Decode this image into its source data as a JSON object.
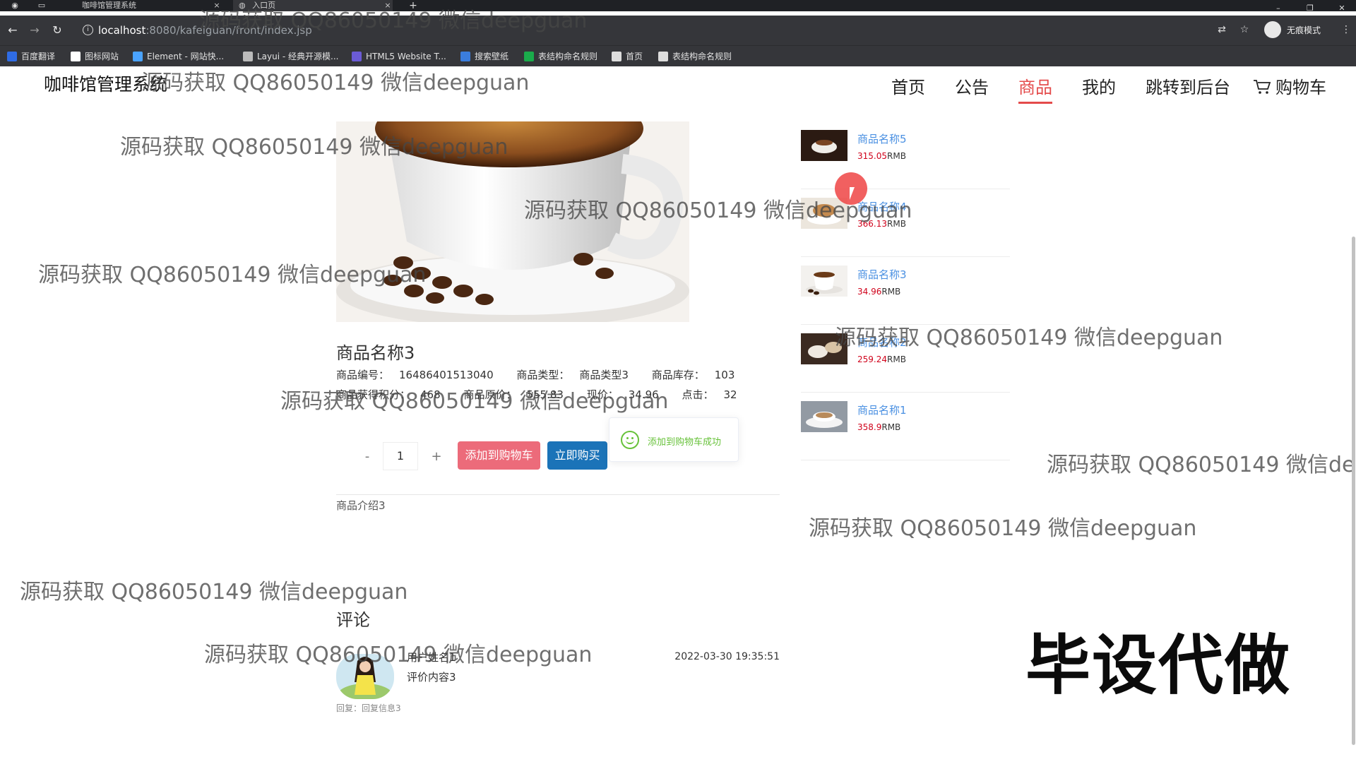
{
  "browser": {
    "tabs": [
      {
        "title": "咖啡馆管理系统",
        "close": "×"
      },
      {
        "title": "入口页",
        "close": "×"
      }
    ],
    "new_tab": "+",
    "window_controls": [
      "–",
      "❐",
      "✕"
    ],
    "url_host": "localhost",
    "url_path": ":8080/kafeiguan/front/index.jsp",
    "incognito_label": "无痕模式",
    "bookmarks": [
      {
        "label": "百度翻译",
        "color": "#2f6ce5"
      },
      {
        "label": "图标网站",
        "color": "#ffffff"
      },
      {
        "label": "Element - 网站快...",
        "color": "#4aa3ff"
      },
      {
        "label": "Layui - 经典开源模...",
        "color": "#bbbbbb"
      },
      {
        "label": "HTML5 Website T...",
        "color": "#6b5bd6"
      },
      {
        "label": "搜索壁纸",
        "color": "#3b7ddd"
      },
      {
        "label": "表结构命名规则",
        "color": "#1aab4b"
      },
      {
        "label": "首页",
        "color": "#dddddd"
      },
      {
        "label": "表结构命名规则",
        "color": "#dddddd"
      }
    ]
  },
  "header": {
    "site_title": "咖啡馆管理系统",
    "nav": [
      "首页",
      "公告",
      "商品",
      "我的",
      "跳转到后台",
      "购物车"
    ],
    "active_nav": "商品",
    "accent_color": "#e44b4b"
  },
  "product": {
    "name": "商品名称3",
    "meta_row1": [
      {
        "label": "商品编号：",
        "value": "16486401513040"
      },
      {
        "label": "商品类型：",
        "value": "商品类型3"
      },
      {
        "label": "商品库存：",
        "value": "103"
      }
    ],
    "meta_row2": [
      {
        "label": "商品获得积分：",
        "value": "468"
      },
      {
        "label": "商品原价：",
        "value": "555.83"
      },
      {
        "label": "现价：",
        "value": "34.96"
      },
      {
        "label": "点击：",
        "value": "32"
      }
    ],
    "quantity": "1",
    "minus": "-",
    "plus": "+",
    "add_to_cart": "添加到购物车",
    "buy_now": "立即购买",
    "toast": "添加到购物车成功",
    "intro": "商品介绍3"
  },
  "comments": {
    "title": "评论",
    "items": [
      {
        "user": "用户姓名1",
        "content": "评价内容3",
        "time": "2022-03-30 19:35:51",
        "reply": "回复：回复信息3"
      }
    ]
  },
  "sidebar": {
    "items": [
      {
        "name": "商品名称5",
        "price": "315.05",
        "unit": "RMB"
      },
      {
        "name": "商品名称4",
        "price": "366.13",
        "unit": "RMB"
      },
      {
        "name": "商品名称3",
        "price": "34.96",
        "unit": "RMB"
      },
      {
        "name": "商品名称2",
        "price": "259.24",
        "unit": "RMB"
      },
      {
        "name": "商品名称1",
        "price": "358.9",
        "unit": "RMB"
      }
    ]
  },
  "overlay": {
    "watermark": "源码获取 QQ86050149 微信deepguan",
    "stamp": "毕设代做"
  }
}
